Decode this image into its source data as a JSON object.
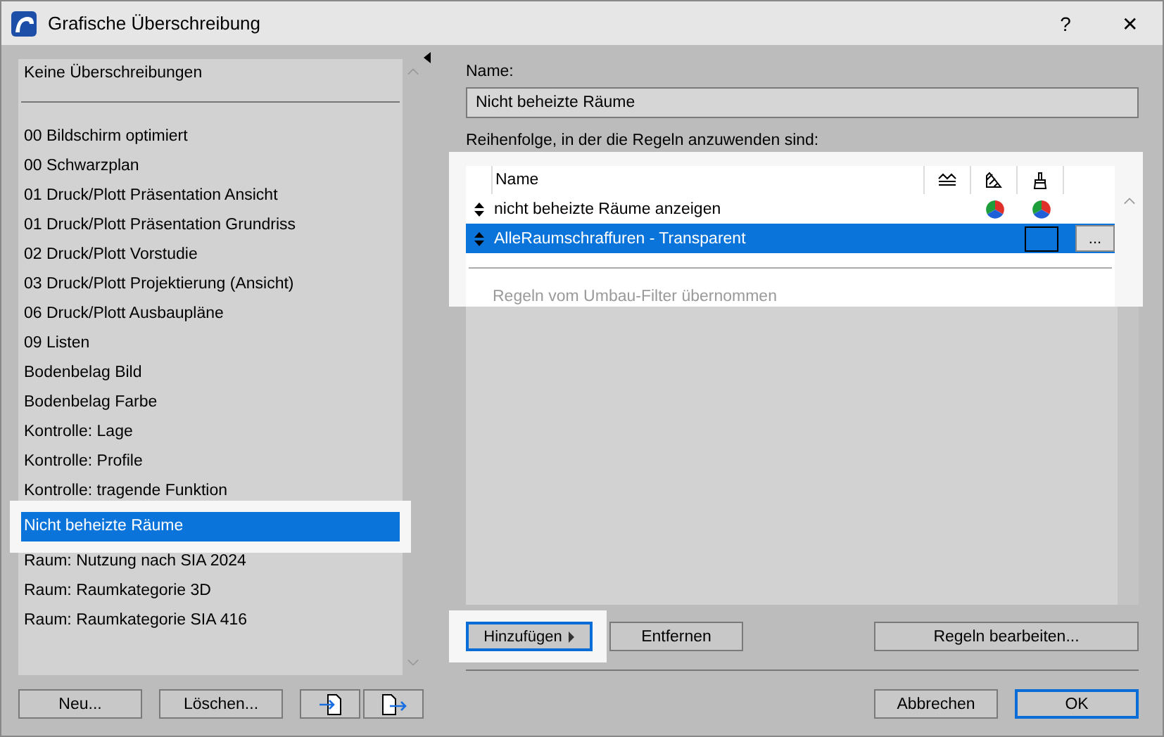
{
  "window": {
    "title": "Grafische Überschreibung",
    "help": "?",
    "close": "✕"
  },
  "overrides": {
    "none_item": "Keine Überschreibungen",
    "items": [
      {
        "label": "00 Bildschirm optimiert",
        "selected": false
      },
      {
        "label": "00 Schwarzplan",
        "selected": false
      },
      {
        "label": "01 Druck/Plott Präsentation Ansicht",
        "selected": false
      },
      {
        "label": "01 Druck/Plott Präsentation Grundriss",
        "selected": false
      },
      {
        "label": "02 Druck/Plott Vorstudie",
        "selected": false
      },
      {
        "label": "03 Druck/Plott Projektierung (Ansicht)",
        "selected": false
      },
      {
        "label": "06 Druck/Plott Ausbaupläne",
        "selected": false
      },
      {
        "label": "09 Listen",
        "selected": false
      },
      {
        "label": "Bodenbelag Bild",
        "selected": false
      },
      {
        "label": "Bodenbelag Farbe",
        "selected": false
      },
      {
        "label": "Kontrolle: Lage",
        "selected": false
      },
      {
        "label": "Kontrolle: Profile",
        "selected": false
      },
      {
        "label": "Kontrolle: tragende Funktion",
        "selected": false
      },
      {
        "label": "Nicht beheizte Räume",
        "selected": true
      },
      {
        "label": "Raum: Nutzung nach SIA 2024",
        "selected": false
      },
      {
        "label": "Raum: Raumkategorie 3D",
        "selected": false
      },
      {
        "label": "Raum: Raumkategorie SIA 416",
        "selected": false
      }
    ],
    "buttons": [
      "Neu...",
      "Löschen..."
    ]
  },
  "name_label": "Name:",
  "name_value": "Nicht beheizte Räume",
  "rules_label": "Reihenfolge, in der die Regeln anzuwenden sind:",
  "rules": {
    "column_header": "Name",
    "rows": [
      {
        "name": "nicht beheizte Räume anzeigen",
        "selected": false,
        "kind": "icons"
      },
      {
        "name": "AlleRaumschraffuren - Transparent",
        "selected": true,
        "kind": "swatch",
        "more": "..."
      }
    ],
    "inherited": "Regeln vom Umbau-Filter übernommen"
  },
  "rule_buttons": {
    "add": "Hinzufügen",
    "remove": "Entfernen",
    "edit": "Regeln bearbeiten..."
  },
  "footer": {
    "cancel": "Abbrechen",
    "ok": "OK"
  }
}
